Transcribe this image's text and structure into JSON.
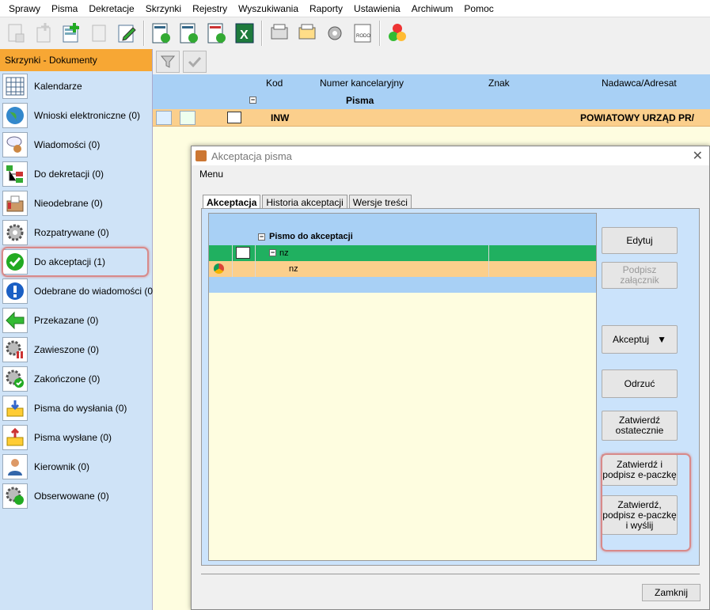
{
  "menu": [
    "Sprawy",
    "Pisma",
    "Dekretacje",
    "Skrzynki",
    "Rejestry",
    "Wyszukiwania",
    "Raporty",
    "Ustawienia",
    "Archiwum",
    "Pomoc"
  ],
  "sidebar": {
    "header": "Skrzynki - Dokumenty",
    "items": [
      {
        "label": "Kalendarze",
        "icon": "calendar-icon"
      },
      {
        "label": "Wnioski elektroniczne (0)",
        "icon": "globe-icon"
      },
      {
        "label": "Wiadomości (0)",
        "icon": "message-icon"
      },
      {
        "label": "Do dekretacji (0)",
        "icon": "tree-icon"
      },
      {
        "label": "Nieodebrane (0)",
        "icon": "box-icon"
      },
      {
        "label": "Rozpatrywane (0)",
        "icon": "gear-icon"
      },
      {
        "label": "Do akceptacji (1)",
        "icon": "check-icon"
      },
      {
        "label": "Odebrane do wiadomości (0)",
        "icon": "info-icon"
      },
      {
        "label": "Przekazane (0)",
        "icon": "arrow-left-icon"
      },
      {
        "label": "Zawieszone (0)",
        "icon": "gear-pause-icon"
      },
      {
        "label": "Zakończone (0)",
        "icon": "gear-check-icon"
      },
      {
        "label": "Pisma do wysłania (0)",
        "icon": "outbox-icon"
      },
      {
        "label": "Pisma wysłane (0)",
        "icon": "sent-icon"
      },
      {
        "label": "Kierownik (0)",
        "icon": "person-icon"
      },
      {
        "label": "Obserwowane (0)",
        "icon": "gear-watch-icon"
      }
    ]
  },
  "grid": {
    "columns": [
      "Kod",
      "Numer kancelaryjny",
      "Znak",
      "Nadawca/Adresat"
    ],
    "group_label": "Pisma",
    "row": {
      "kod": "INW",
      "nadawca": "POWIATOWY URZĄD PR/"
    }
  },
  "dialog": {
    "title": "Akceptacja pisma",
    "menu": "Menu",
    "tabs": [
      "Akceptacja",
      "Historia akceptacji",
      "Wersje treści"
    ],
    "tree": {
      "group": "Pismo do akceptacji",
      "row1": "nz",
      "row2": "nz"
    },
    "buttons": {
      "edit": "Edytuj",
      "sign_attachment": "Podpisz załącznik",
      "accept": "Akceptuj",
      "reject": "Odrzuć",
      "approve_final_1": "Zatwierdź",
      "approve_final_2": "ostatecznie",
      "approve_sign_1": "Zatwierdź i",
      "approve_sign_2": "podpisz e-paczkę",
      "approve_send_1": "Zatwierdź,",
      "approve_send_2": "podpisz e-paczkę",
      "approve_send_3": "i wyślij",
      "close": "Zamknij"
    },
    "accept_arrow": "▼"
  },
  "colors": {
    "sidebar_header": "#f7a734",
    "accent_green": "#20b060",
    "row_orange": "#fbcf8c",
    "grid_blue": "#a8d0f5"
  }
}
